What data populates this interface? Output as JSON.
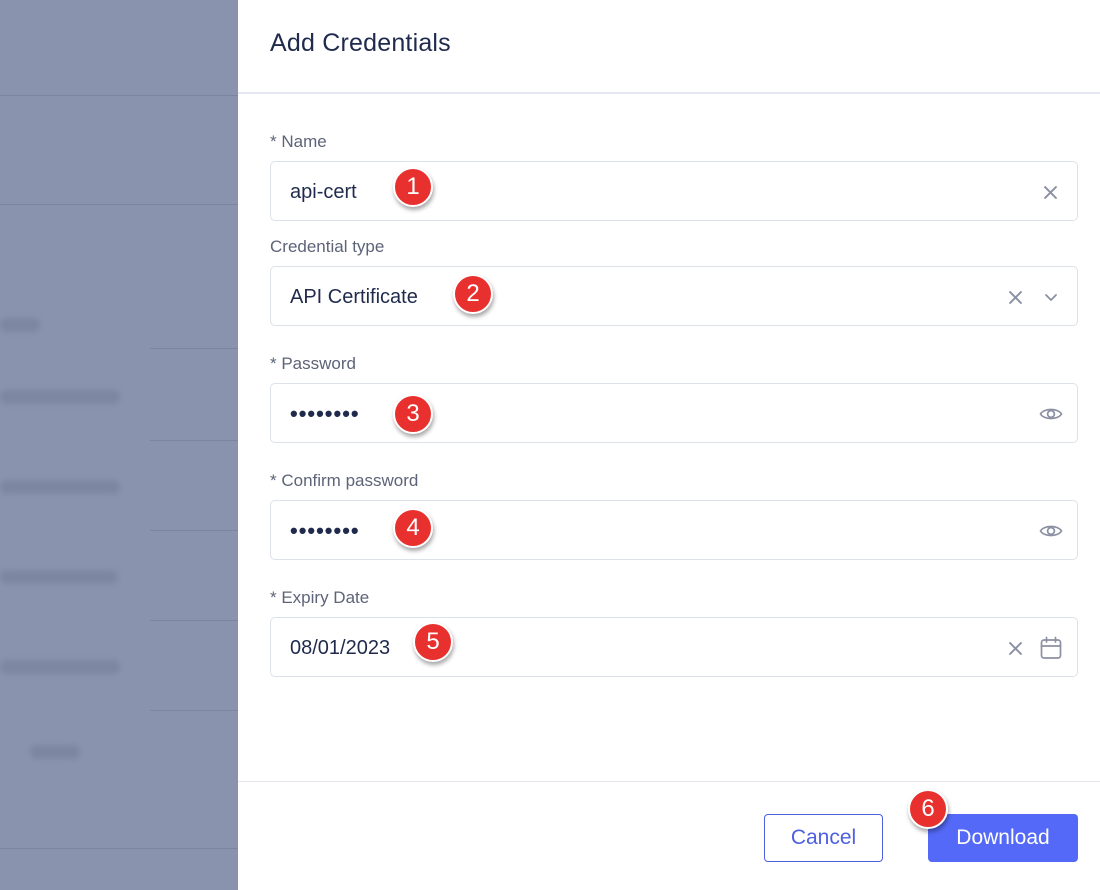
{
  "drawer": {
    "title": "Add Credentials"
  },
  "form": {
    "name": {
      "label": "* Name",
      "value": "api-cert"
    },
    "credential_type": {
      "label": "Credential type",
      "value": "API Certificate"
    },
    "password": {
      "label": "* Password",
      "value": "••••••••"
    },
    "confirm_password": {
      "label": "* Confirm password",
      "value": "••••••••"
    },
    "expiry_date": {
      "label": "* Expiry Date",
      "value": "08/01/2023"
    }
  },
  "markers": [
    "1",
    "2",
    "3",
    "4",
    "5",
    "6"
  ],
  "footer": {
    "cancel_label": "Cancel",
    "download_label": "Download"
  },
  "icons": {
    "clear": "close-icon",
    "dropdown": "chevron-down-icon",
    "reveal": "eye-icon",
    "calendar": "calendar-icon"
  },
  "colors": {
    "accent": "#5469f7",
    "marker": "#e8312f",
    "overlay": "#8a93ad"
  }
}
